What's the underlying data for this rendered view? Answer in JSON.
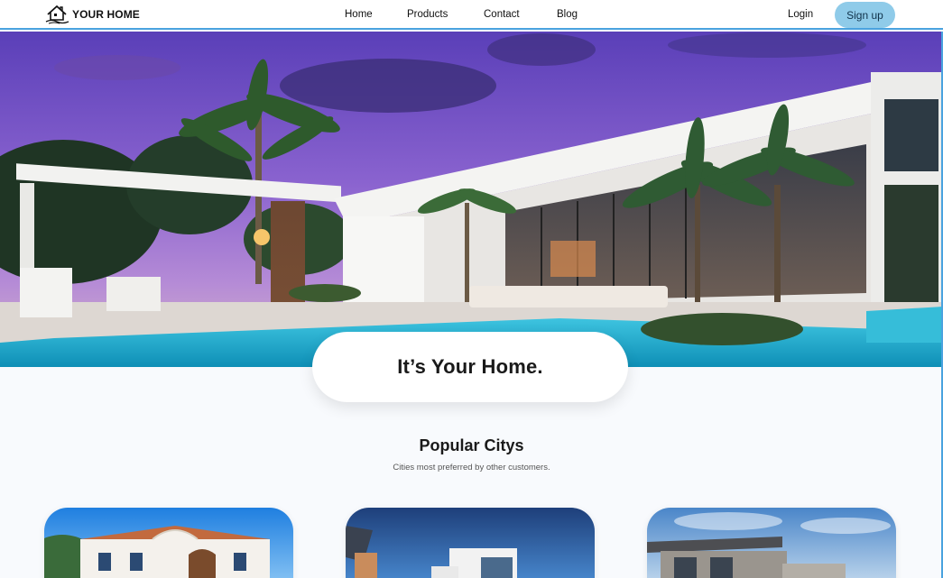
{
  "brand": {
    "name": "YOUR HOME",
    "icon": "house-logo-icon"
  },
  "nav": {
    "links": [
      "Home",
      "Products",
      "Contact",
      "Blog"
    ],
    "login_label": "Login",
    "signup_label": "Sign up"
  },
  "hero": {
    "tagline": "It’s Your Home."
  },
  "popular": {
    "title": "Popular Citys",
    "subtitle": "Cities most preferred by other customers."
  },
  "colors": {
    "accent": "#8fcbe9",
    "nav_border": "#4aa3df",
    "background": "#f8fafd"
  }
}
